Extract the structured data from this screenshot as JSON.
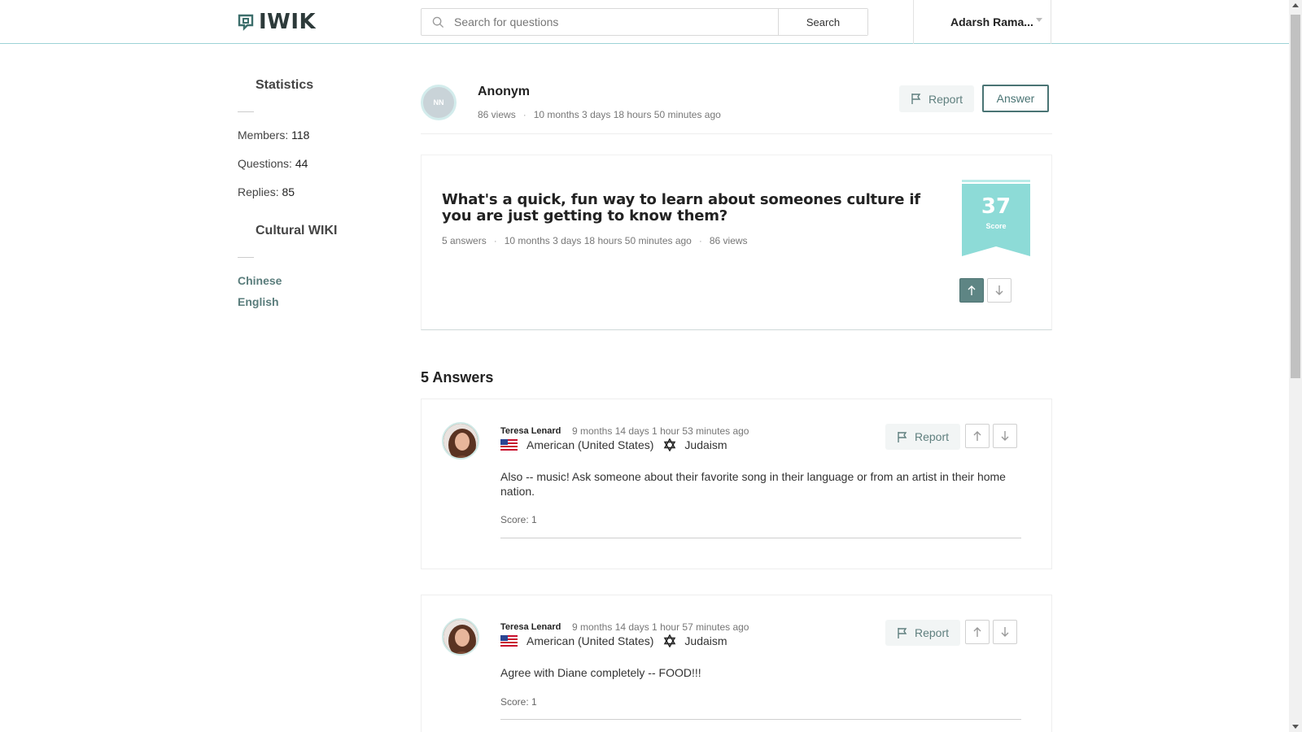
{
  "header": {
    "logo_text": "IWIK",
    "search_placeholder": "Search for questions",
    "search_button": "Search",
    "user_name": "Adarsh Rama..."
  },
  "sidebar": {
    "statistics_heading": "Statistics",
    "stats": [
      {
        "label": "Members:",
        "value": "118"
      },
      {
        "label": "Questions:",
        "value": "44"
      },
      {
        "label": "Replies:",
        "value": "85"
      }
    ],
    "wiki_heading": "Cultural WIKI",
    "wiki_links": [
      "Chinese",
      "English"
    ]
  },
  "question": {
    "asker_initials": "NN",
    "asker_name": "Anonym",
    "asker_views": "86 views",
    "asker_time": "10 months 3 days 18 hours 50 minutes ago",
    "report_label": "Report",
    "answer_label": "Answer",
    "title": "What's a quick, fun way to learn about someones culture if you are just getting to know them?",
    "answers_count": "5 answers",
    "time": "10 months 3 days 18 hours 50 minutes ago",
    "views": "86 views",
    "score": "37",
    "score_label": "Score",
    "ribbon_color": "#8ddbd7",
    "active_vote_color": "#5e8584"
  },
  "answers_heading": "5 Answers",
  "answers": [
    {
      "author": "Teresa Lenard",
      "time": "9 months 14 days 1 hour 53 minutes ago",
      "nationality": "American (United States)",
      "religion": "Judaism",
      "report_label": "Report",
      "body": "Also -- music! Ask someone about their favorite song in their language or from an artist in their home nation.",
      "score": "Score: 1"
    },
    {
      "author": "Teresa Lenard",
      "time": "9 months 14 days 1 hour 57 minutes ago",
      "nationality": "American (United States)",
      "religion": "Judaism",
      "report_label": "Report",
      "body": "Agree with Diane completely -- FOOD!!!",
      "score": "Score: 1"
    }
  ]
}
